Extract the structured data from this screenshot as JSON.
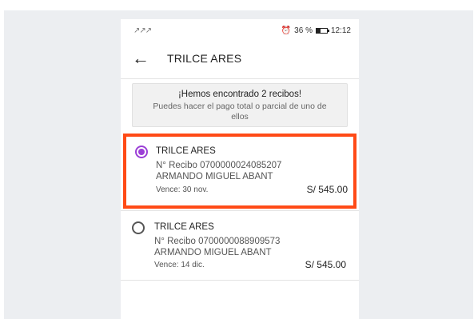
{
  "status": {
    "signal": "↗↗↗",
    "alarm_icon": "alarm-icon",
    "battery_percent": "36 %",
    "time": "12:12"
  },
  "appbar": {
    "back_icon": "back-arrow-icon",
    "title": "TRILCE ARES"
  },
  "banner": {
    "heading": "¡Hemos encontrado 2 recibos!",
    "subtext": "Puedes hacer el pago total o parcial de uno de ellos"
  },
  "receipts": [
    {
      "selected": true,
      "school": "TRILCE ARES",
      "receipt_number": "N° Recibo 0700000024085207",
      "student": "ARMANDO MIGUEL ABANT",
      "due": "Vence: 30 nov.",
      "amount": "S/ 545.00"
    },
    {
      "selected": false,
      "school": "TRILCE ARES",
      "receipt_number": "N° Recibo 0700000088909573",
      "student": "ARMANDO MIGUEL ABANT",
      "due": "Vence: 14 dic.",
      "amount": "S/ 545.00"
    }
  ],
  "colors": {
    "accent_radio": "#9b3fd6",
    "highlight_border": "#ff4a16"
  }
}
